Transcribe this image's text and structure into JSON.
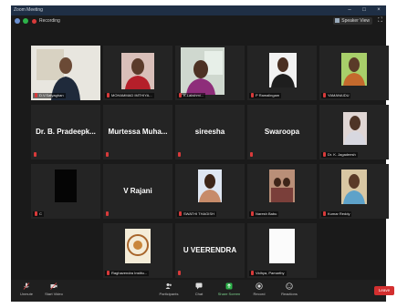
{
  "window": {
    "title": "Zoom Meeting",
    "minimize": "–",
    "maximize": "□",
    "close": "×"
  },
  "topbar": {
    "recording_label": "Recording",
    "speaker_view_label": "Speaker View",
    "fullscreen_glyph": "⛶"
  },
  "participants": [
    {
      "name": "D.V.Satyaghan",
      "display": "video"
    },
    {
      "name": "MOHAMMAD IMTHIYA...",
      "display": "photo"
    },
    {
      "name": "K.Lakshmi...",
      "display": "photo"
    },
    {
      "name": "P Ramalingam",
      "display": "photo"
    },
    {
      "name": "YAMANAIDU",
      "display": "photo"
    },
    {
      "name": "Dr. B. Pradeepk...",
      "display": "name"
    },
    {
      "name": "Murtessa Muha...",
      "display": "name"
    },
    {
      "name": "sireesha",
      "display": "name"
    },
    {
      "name": "Swaroopa",
      "display": "name"
    },
    {
      "name": "Dr. K. Jagadeesh",
      "display": "photo"
    },
    {
      "name": "C",
      "display": "photo"
    },
    {
      "name": "V Rajani",
      "display": "name"
    },
    {
      "name": "SWATHI THAGISH",
      "display": "photo"
    },
    {
      "name": "Naresh Babu",
      "display": "photo"
    },
    {
      "name": "Kumar Reddy",
      "display": "photo"
    },
    {
      "name": "Raghavendra Institu...",
      "display": "photo"
    },
    {
      "name": "U VEERENDRA",
      "display": "name"
    },
    {
      "name": "Vidhya, Pamarthy",
      "display": "photo"
    }
  ],
  "toolbar": {
    "unmute": "Unmute",
    "start_video": "Start Video",
    "participants": "Participants",
    "participants_count": "18",
    "chat": "Chat",
    "share_screen": "Share Screen",
    "record": "Record",
    "reactions": "Reactions",
    "leave": "Leave"
  },
  "colors": {
    "active_speaker": "#c8e14a",
    "leave": "#d32f2f",
    "share": "#2db24a",
    "mic_off": "#d83a3a"
  }
}
